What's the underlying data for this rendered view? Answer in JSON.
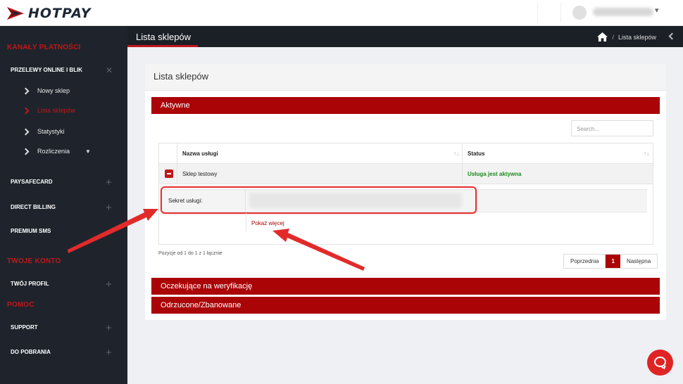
{
  "brand": {
    "name": "HOTPAY",
    "accent": "#aa0407"
  },
  "sidebar": {
    "sections": [
      {
        "label": "KANAŁY PŁATNOŚCI"
      },
      {
        "label": "TWOJE KONTO"
      },
      {
        "label": "POMOC"
      }
    ],
    "items": [
      {
        "label": "PRZELEWY ONLINE I BLIK",
        "expanded": true
      },
      {
        "label": "PAYSAFECARD"
      },
      {
        "label": "DIRECT BILLING"
      },
      {
        "label": "PREMIUM SMS"
      },
      {
        "label": "TWÓJ PROFIL"
      },
      {
        "label": "SUPPORT"
      },
      {
        "label": "DO POBRANIA"
      }
    ],
    "subitems": [
      {
        "label": "Nowy sklep"
      },
      {
        "label": "Lista sklepów",
        "active": true
      },
      {
        "label": "Statystyki"
      },
      {
        "label": "Rozliczenia"
      }
    ]
  },
  "header": {
    "title": "Lista sklepów",
    "breadcrumb": "Lista sklepów"
  },
  "panel": {
    "title": "Lista sklepów",
    "groups": {
      "active": "Aktywne",
      "pending": "Oczekujące na weryfikację",
      "rejected": "Odrzucone/Zbanowane"
    },
    "search_placeholder": "Search...",
    "table": {
      "columns": [
        "Nazwa usługi",
        "Status"
      ],
      "rows": [
        {
          "name": "Sklep testowy",
          "status": "Usługa jest aktywna"
        }
      ],
      "detail_label": "Sekret usługi:",
      "show_more": "Pokaż więcej"
    },
    "info": "Pozycje od 1 do 1 z 1 łącznie",
    "pagination": {
      "prev": "Poprzednia",
      "current": "1",
      "next": "Następna"
    }
  }
}
